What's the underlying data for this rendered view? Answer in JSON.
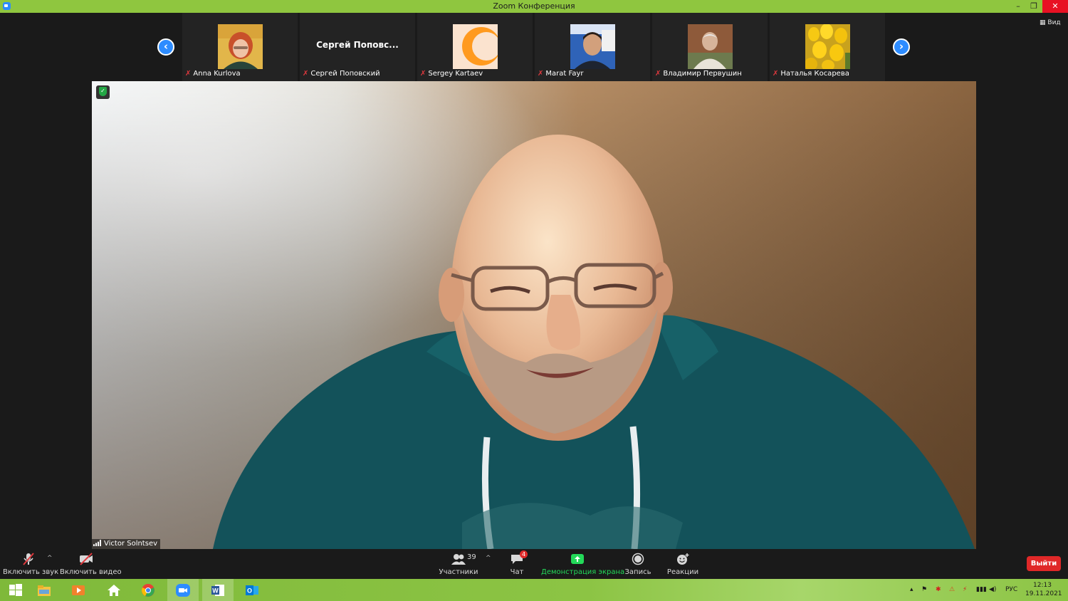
{
  "window": {
    "title": "Zoom Конференция",
    "minimize_glyph": "–",
    "maximize_glyph": "❐",
    "close_glyph": "✕"
  },
  "gallery": {
    "prev_glyph": "‹",
    "next_glyph": "›",
    "view_label": "Вид",
    "participants": [
      {
        "name": "Anna Kurlova",
        "muted": true,
        "thumb": "photo-woman-red-hair"
      },
      {
        "name": "Сергей Поповский",
        "display_text": "Сергей  Поповс...",
        "muted": true,
        "thumb": "name-only"
      },
      {
        "name": "Sergey Kartaev",
        "muted": true,
        "thumb": "orange-logo"
      },
      {
        "name": "Marat Fayr",
        "muted": true,
        "thumb": "photo-man-flag"
      },
      {
        "name": "Владимир Первушин",
        "muted": true,
        "thumb": "photo-man-brick"
      },
      {
        "name": "Наталья Косарева",
        "muted": true,
        "thumb": "photo-tulips"
      }
    ]
  },
  "speaker": {
    "name": "Victor Solntsev"
  },
  "toolbar": {
    "unmute_label": "Включить звук",
    "start_video_label": "Включить видео",
    "participants_label": "Участники",
    "participants_count": "39",
    "chat_label": "Чат",
    "chat_unread": "4",
    "share_label": "Демонстрация экрана",
    "record_label": "Запись",
    "reactions_label": "Реакции",
    "leave_label": "Выйти",
    "caret_glyph": "^"
  },
  "taskbar": {
    "apps": [
      "start-icon",
      "file-explorer-icon",
      "media-player-icon",
      "home-icon",
      "chrome-icon",
      "zoom-icon",
      "word-icon",
      "outlook-icon"
    ],
    "active_app": "zoom-icon",
    "language": "РУС",
    "time": "12:13",
    "date": "19.11.2021"
  },
  "colors": {
    "zoom_blue": "#2d8cff",
    "titlebar_green": "#8fc63f",
    "leave_red": "#e02828",
    "share_green": "#23d959",
    "muted_red": "#e0393e"
  }
}
